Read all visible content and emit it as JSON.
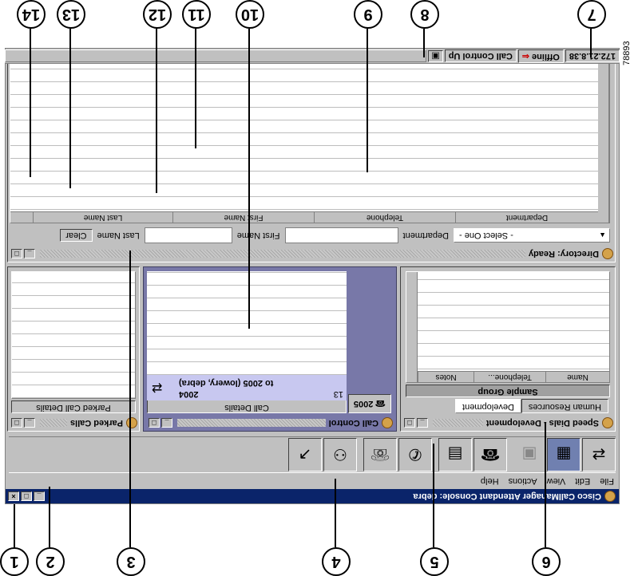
{
  "app": {
    "title": "Cisco CallManager Attendant Console: debra",
    "window_buttons": [
      "_",
      "□",
      "×"
    ]
  },
  "menu": [
    "File",
    "Edit",
    "View",
    "Actions",
    "Help"
  ],
  "toolbar": {
    "icons": [
      "call-transfer-icon",
      "dial-pad-icon",
      "disabled-icon",
      "hang-up-icon",
      "directory-transfer-icon",
      "hold-icon",
      "answer-icon",
      "conference-icon",
      "pickup-icon"
    ]
  },
  "speed_dials": {
    "title": "Speed Dials - Development",
    "columns": [
      "Name",
      "Telephone...",
      "Notes"
    ],
    "group_label": "Sample Group",
    "tabs": [
      "Human Resources",
      "Development"
    ]
  },
  "call_control": {
    "title": "Call Control",
    "details_label": "Call Details",
    "call_row": {
      "line1": "2004",
      "line2": "to 2005 (lowery, debra)",
      "number": "13"
    },
    "line_button": "2005"
  },
  "parked_calls": {
    "title": "Parked Calls",
    "details_label": "Parked Call Details"
  },
  "directory": {
    "status": "Directory: Ready",
    "clear_button": "Clear",
    "last_name_label": "Last Name",
    "first_name_label": "First Name",
    "department_label": "Department",
    "department_value": "- Select One -",
    "columns": [
      "Last Name",
      "First Name",
      "Telephone",
      "Department"
    ]
  },
  "status_bar": {
    "call_control": "Call Control Up",
    "mode": "Offline",
    "ip": "172.21.8.38"
  },
  "figure_id": "78893",
  "callouts": [
    "1",
    "2",
    "3",
    "4",
    "5",
    "6",
    "7",
    "8",
    "9",
    "10",
    "11",
    "12",
    "13",
    "14"
  ]
}
